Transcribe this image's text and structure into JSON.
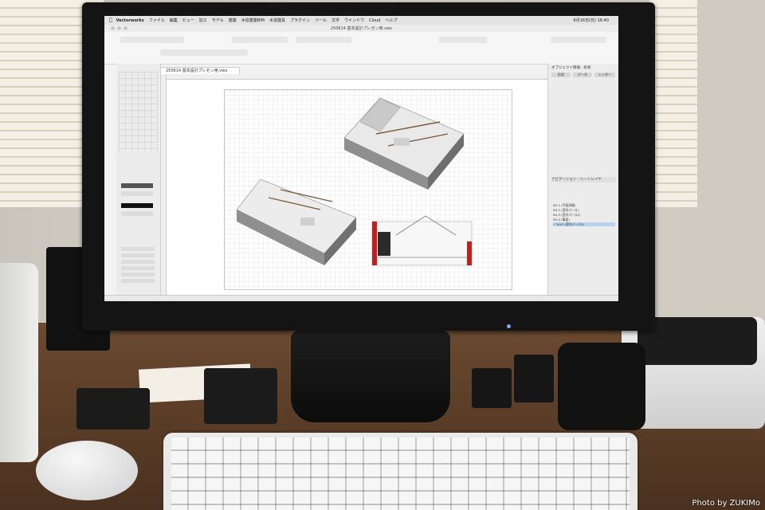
{
  "menubar": {
    "app_name": "Vectorworks",
    "items": [
      "ファイル",
      "編集",
      "ビュー",
      "加工",
      "モデル",
      "建築",
      "木造建築BIM",
      "木造建具",
      "プラグイン",
      "ツール",
      "文字",
      "ウインドウ",
      "Cloud",
      "ヘルプ"
    ],
    "clock": "6月16日(日) 16:40"
  },
  "window": {
    "title": "250614 基本設計プレゼン用.vwx",
    "doc_tab": "250614 基本設計プレゼン用.vwx"
  },
  "right_panel": {
    "obj_info_header": "オブジェクト情報 - 形状",
    "tabs": [
      "形状",
      "データ",
      "レンダー"
    ],
    "nav_header": "ナビゲーション - シートレイヤ",
    "nav_rows": [
      {
        "num": "SH-1",
        "name": "(平面詳細)",
        "selected": false
      },
      {
        "num": "SH-2",
        "name": "(室内パース)",
        "selected": false
      },
      {
        "num": "SH-3",
        "name": "(室内パース2)",
        "selected": false
      },
      {
        "num": "SH-4",
        "name": "(断面)",
        "selected": false
      },
      {
        "num": "SH-5",
        "name": "(室内パース3)",
        "selected": true
      }
    ]
  },
  "credit": "Photo by ZUKIMo",
  "colors": {
    "desk": "#4a311f",
    "wall": "#d3cec6",
    "monitor_bezel": "#141414",
    "selection": "#b9d3ef",
    "section_red": "#c41e1e"
  }
}
